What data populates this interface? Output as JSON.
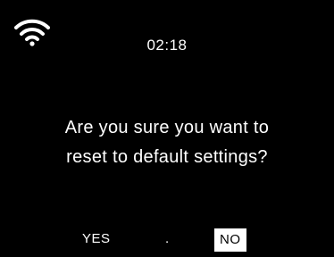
{
  "status_bar": {
    "icon": "wifi-icon",
    "time": "02:18"
  },
  "dialog": {
    "line1": "Are you sure you want to",
    "line2": "reset to default settings?"
  },
  "options": {
    "yes_label": "YES",
    "separator": ".",
    "no_label": "NO",
    "selected": "NO"
  },
  "colors": {
    "background": "#000000",
    "text": "#ffffff",
    "selection_bg": "#ffffff",
    "selection_text": "#000000"
  }
}
